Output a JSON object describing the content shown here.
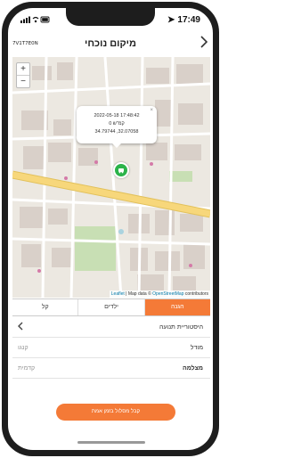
{
  "status": {
    "time": "17:49",
    "location_arrow": "➤"
  },
  "header": {
    "title": "מיקום נוכחי",
    "device_id": "7V1T7E0N",
    "back_icon": "chevron-right"
  },
  "map": {
    "zoom_in": "+",
    "zoom_out": "−",
    "popup": {
      "line1": "2022-05-18 17:48:42",
      "line2": "0 קמ\"ש",
      "line3": "34.79744 ,32.07058",
      "close": "×"
    },
    "marker_icon": "car-marker",
    "attribution": {
      "leaflet": "Leaflet",
      "sep": " | Map data © ",
      "osm": "OpenStreetMap",
      "tail": " contributors"
    },
    "colors": {
      "land": "#ece8e1",
      "road_major": "#f7d77b",
      "road": "#ffffff",
      "building": "#d9d0c9",
      "park": "#c8dfb4",
      "water": "#aad3df"
    }
  },
  "tabs": [
    {
      "label": "הגנה",
      "active": true
    },
    {
      "label": "ילדים",
      "active": false
    },
    {
      "label": "קל",
      "active": false
    }
  ],
  "rows": {
    "history": "היסטוריית תנועה",
    "row2_right": "מודל",
    "row2_left": "קנגו",
    "row3_right": "מצלמה",
    "row3_left": "קדמית"
  },
  "cta": {
    "label": "קבל מסלול בזמן אמת"
  },
  "accent": "#f47a37"
}
